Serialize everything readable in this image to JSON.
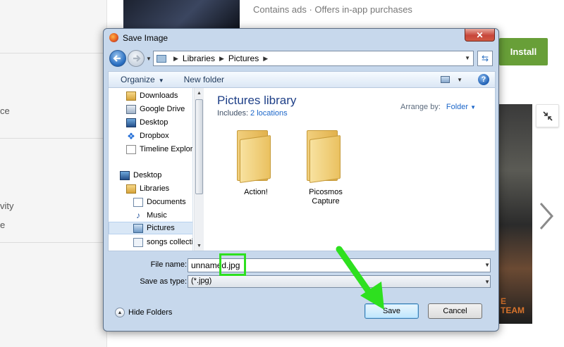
{
  "background": {
    "left_items": [
      "ce",
      "vity",
      "e"
    ],
    "app_subtitle": "Contains ads · Offers in-app purchases",
    "install_label": "Install",
    "screenshot_text": "E\nTEAM"
  },
  "dialog": {
    "title": "Save Image",
    "address": {
      "crumbs": [
        "Libraries",
        "Pictures"
      ]
    },
    "toolbar": {
      "organize_label": "Organize",
      "new_folder_label": "New folder"
    },
    "nav_items": [
      {
        "label": "Downloads",
        "icon": "downloads-folder-icon"
      },
      {
        "label": "Google Drive",
        "icon": "google-drive-icon"
      },
      {
        "label": "Desktop",
        "icon": "desktop-icon"
      },
      {
        "label": "Dropbox",
        "icon": "dropbox-icon"
      },
      {
        "label": "Timeline Explor",
        "icon": "document-icon"
      },
      {
        "label": "Desktop",
        "icon": "desktop-icon"
      },
      {
        "label": "Libraries",
        "icon": "libraries-icon"
      },
      {
        "label": "Documents",
        "icon": "documents-icon"
      },
      {
        "label": "Music",
        "icon": "music-icon"
      },
      {
        "label": "Pictures",
        "icon": "pictures-icon",
        "selected": true
      },
      {
        "label": "songs collecti",
        "icon": "songs-icon"
      }
    ],
    "library": {
      "title": "Pictures library",
      "includes_label": "Includes:",
      "includes_link": "2 locations",
      "arrange_label": "Arrange by:",
      "arrange_value": "Folder"
    },
    "folders": [
      {
        "label": "Action!"
      },
      {
        "label": "Picosmos\nCapture"
      }
    ],
    "file_name_label": "File name:",
    "file_name_value": "unnamed.jpg",
    "save_type_label": "Save as type:",
    "save_type_value": "(*.jpg)",
    "hide_folders_label": "Hide Folders",
    "save_label": "Save",
    "cancel_label": "Cancel",
    "close_glyph": "✕",
    "help_glyph": "?",
    "refresh_glyph": "⇆"
  },
  "colors": {
    "install": "#689f38",
    "annotation": "#2ee01f",
    "dialog_frame": "#c7d8ec"
  }
}
